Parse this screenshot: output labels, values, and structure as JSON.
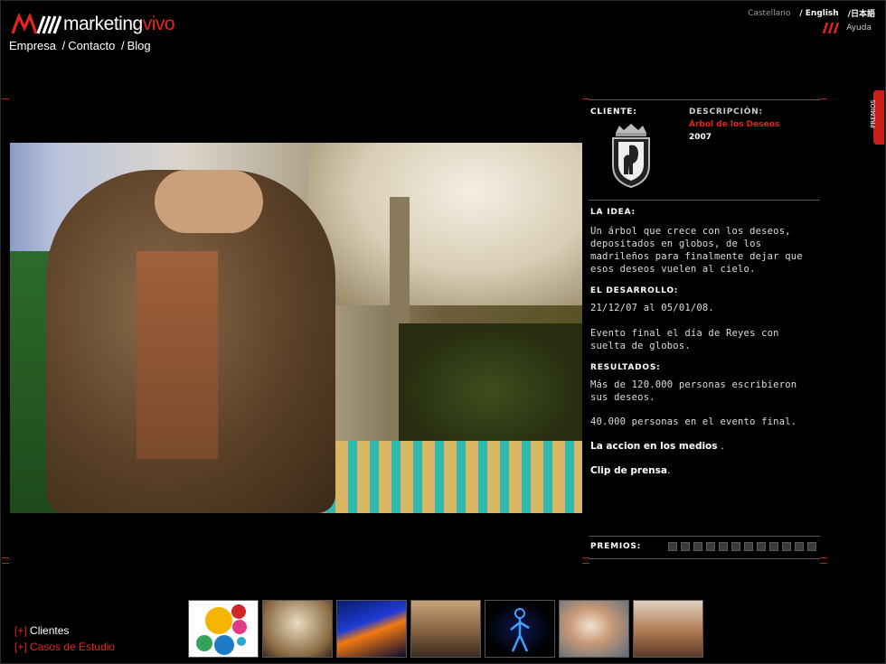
{
  "brand": {
    "name_a": "marketing",
    "name_b": "vivo"
  },
  "top_nav": {
    "items": [
      "Empresa",
      "Contacto",
      "Blog"
    ],
    "sep": "/"
  },
  "languages": [
    "Castellano",
    "/ English",
    "/日本語"
  ],
  "help": "Ayuda",
  "side_tab": "PREMIOS",
  "client": {
    "cliente_label": "CLIENTE:",
    "descripcion_label": "DESCRIPCIÓN:",
    "project_title": "Árbol de los Deseos",
    "year": "2007"
  },
  "idea": {
    "label": "LA IDEA:",
    "text": "Un árbol que crece con los deseos, depositados en globos, de los madrileños para finalmente dejar que esos deseos vuelen al cielo."
  },
  "desarrollo": {
    "label": "EL DESARROLLO:",
    "dates": "21/12/07 al 05/01/08.",
    "text": "Evento final el día de Reyes con suelta de globos."
  },
  "resultados": {
    "label": "RESULTADOS:",
    "text1": "Más de 120.000 personas escribieron sus deseos.",
    "text2": "40.000 personas en el evento final."
  },
  "links": {
    "medios": "La accion en los medios",
    "medios_suffix": ".",
    "prensa": "Clip de prensa",
    "prensa_suffix": "."
  },
  "premios": {
    "label": "PREMIOS:",
    "count": 12
  },
  "bottom_nav": {
    "prefix": "[+]",
    "clientes": "Clientes",
    "casos": "Casos de Estudio"
  },
  "colors": {
    "accent": "#e8231c",
    "background": "#000000"
  }
}
